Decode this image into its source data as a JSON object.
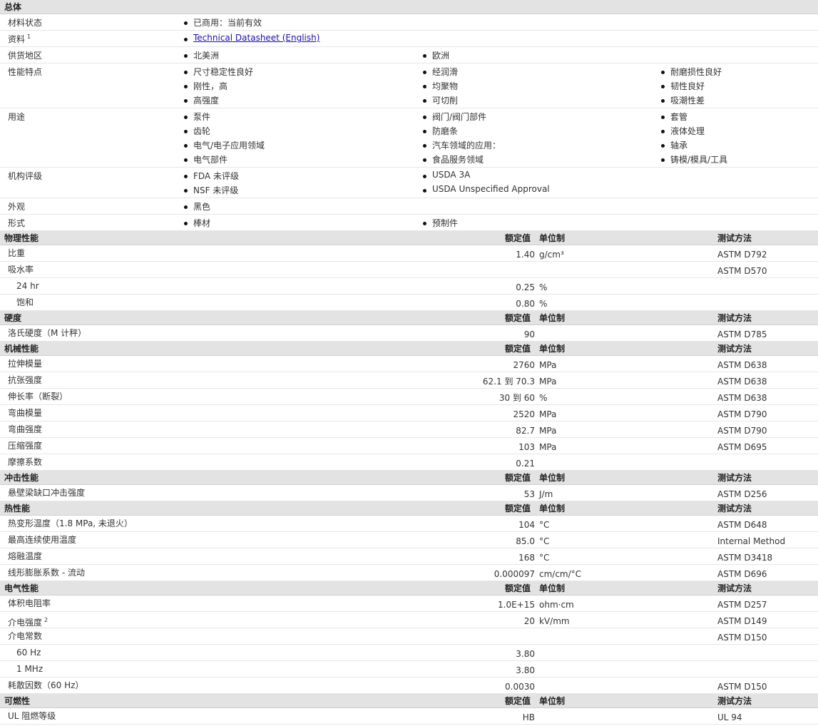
{
  "general": {
    "title": "总体",
    "rows": [
      {
        "label": "材料状态",
        "sup": "",
        "height": 0,
        "items": [
          {
            "text": "已商用：当前有效",
            "col": 0,
            "line": 0
          }
        ]
      },
      {
        "label": "资料",
        "sup": "1",
        "items": [
          {
            "text": "Technical Datasheet (English)",
            "col": 0,
            "line": 0,
            "link": true
          }
        ]
      },
      {
        "label": "供货地区",
        "sup": "",
        "items": [
          {
            "text": "北美洲",
            "col": 0,
            "line": 0
          },
          {
            "text": "欧洲",
            "col": 1,
            "line": 0
          }
        ]
      },
      {
        "label": "性能特点",
        "sup": "",
        "items": [
          {
            "text": "尺寸稳定性良好",
            "col": 0,
            "line": 0
          },
          {
            "text": "经润滑",
            "col": 1,
            "line": 0
          },
          {
            "text": "耐磨损性良好",
            "col": 2,
            "line": 0
          },
          {
            "text": "刚性，高",
            "col": 0,
            "line": 1
          },
          {
            "text": "均聚物",
            "col": 1,
            "line": 1
          },
          {
            "text": "韧性良好",
            "col": 2,
            "line": 1
          },
          {
            "text": "高强度",
            "col": 0,
            "line": 2
          },
          {
            "text": "可切削",
            "col": 1,
            "line": 2
          },
          {
            "text": "吸潮性差",
            "col": 2,
            "line": 2
          }
        ]
      },
      {
        "label": "用途",
        "sup": "",
        "items": [
          {
            "text": "泵件",
            "col": 0,
            "line": 0
          },
          {
            "text": "阀门/阀门部件",
            "col": 1,
            "line": 0
          },
          {
            "text": "套管",
            "col": 2,
            "line": 0
          },
          {
            "text": "齿轮",
            "col": 0,
            "line": 1
          },
          {
            "text": "防磨条",
            "col": 1,
            "line": 1
          },
          {
            "text": "液体处理",
            "col": 2,
            "line": 1
          },
          {
            "text": "电气/电子应用领域",
            "col": 0,
            "line": 2
          },
          {
            "text": "汽车领域的应用：",
            "col": 1,
            "line": 2
          },
          {
            "text": "轴承",
            "col": 2,
            "line": 2
          },
          {
            "text": "电气部件",
            "col": 0,
            "line": 3
          },
          {
            "text": "食品服务领域",
            "col": 1,
            "line": 3
          },
          {
            "text": "铸模/模具/工具",
            "col": 2,
            "line": 3
          }
        ]
      },
      {
        "label": "机构评级",
        "sup": "",
        "items": [
          {
            "text": "FDA 未评级",
            "col": 0,
            "line": 0
          },
          {
            "text": "USDA 3A",
            "col": 1,
            "line": 0
          },
          {
            "text": "NSF 未评级",
            "col": 0,
            "line": 1
          },
          {
            "text": "USDA Unspecified Approval",
            "col": 1,
            "line": 1
          }
        ]
      },
      {
        "label": "外观",
        "sup": "",
        "items": [
          {
            "text": "黑色",
            "col": 0,
            "line": 0
          }
        ]
      },
      {
        "label": "形式",
        "sup": "",
        "items": [
          {
            "text": "棒材",
            "col": 0,
            "line": 0
          },
          {
            "text": "预制件",
            "col": 1,
            "line": 0
          }
        ]
      }
    ]
  },
  "headers": {
    "nominal": "额定值",
    "unit": "单位制",
    "method": "测试方法"
  },
  "sections": [
    {
      "title": "物理性能",
      "rows": [
        {
          "label": "比重",
          "sub": false,
          "value": "1.40",
          "unit": "g/cm³",
          "method": "ASTM D792"
        },
        {
          "label": "吸水率",
          "sub": false,
          "value": "",
          "unit": "",
          "method": "ASTM D570"
        },
        {
          "label": "24 hr",
          "sub": true,
          "value": "0.25",
          "unit": "%",
          "method": ""
        },
        {
          "label": "饱和",
          "sub": true,
          "value": "0.80",
          "unit": "%",
          "method": ""
        }
      ]
    },
    {
      "title": "硬度",
      "rows": [
        {
          "label": "洛氏硬度（M 计秤）",
          "sub": false,
          "value": "90",
          "unit": "",
          "method": "ASTM D785"
        }
      ]
    },
    {
      "title": "机械性能",
      "rows": [
        {
          "label": "拉伸模量",
          "sub": false,
          "value": "2760",
          "unit": "MPa",
          "method": "ASTM D638"
        },
        {
          "label": "抗张强度",
          "sub": false,
          "value": "62.1 到  70.3",
          "unit": "MPa",
          "method": "ASTM D638"
        },
        {
          "label": "伸长率（断裂）",
          "sub": false,
          "value": "30 到  60",
          "unit": "%",
          "method": "ASTM D638"
        },
        {
          "label": "弯曲模量",
          "sub": false,
          "value": "2520",
          "unit": "MPa",
          "method": "ASTM D790"
        },
        {
          "label": "弯曲强度",
          "sub": false,
          "value": "82.7",
          "unit": "MPa",
          "method": "ASTM D790"
        },
        {
          "label": "压缩强度",
          "sub": false,
          "value": "103",
          "unit": "MPa",
          "method": "ASTM D695"
        },
        {
          "label": "摩擦系数",
          "sub": false,
          "value": "0.21",
          "unit": "",
          "method": ""
        }
      ]
    },
    {
      "title": "冲击性能",
      "rows": [
        {
          "label": "悬壁梁缺口冲击强度",
          "sub": false,
          "value": "53",
          "unit": "J/m",
          "method": "ASTM D256"
        }
      ]
    },
    {
      "title": "热性能",
      "rows": [
        {
          "label": "热变形温度（1.8 MPa, 未退火）",
          "sub": false,
          "value": "104",
          "unit": "°C",
          "method": "ASTM D648"
        },
        {
          "label": "最高连续使用温度",
          "sub": false,
          "value": "85.0",
          "unit": "°C",
          "method": "Internal Method"
        },
        {
          "label": "熔融温度",
          "sub": false,
          "value": "168",
          "unit": "°C",
          "method": "ASTM D3418"
        },
        {
          "label": "线形膨胀系数  - 流动",
          "sub": false,
          "value": "0.000097",
          "unit": "cm/cm/°C",
          "method": "ASTM D696"
        }
      ]
    },
    {
      "title": "电气性能",
      "rows": [
        {
          "label": "体积电阻率",
          "sub": false,
          "value": "1.0E+15",
          "unit": "ohm·cm",
          "method": "ASTM D257"
        },
        {
          "label": "介电强度",
          "sup": "2",
          "sub": false,
          "value": "20",
          "unit": "kV/mm",
          "method": "ASTM D149"
        },
        {
          "label": "介电常数",
          "sub": false,
          "value": "",
          "unit": "",
          "method": "ASTM D150"
        },
        {
          "label": "60 Hz",
          "sub": true,
          "value": "3.80",
          "unit": "",
          "method": ""
        },
        {
          "label": "1 MHz",
          "sub": true,
          "value": "3.80",
          "unit": "",
          "method": ""
        },
        {
          "label": "耗散因数（60 Hz）",
          "sub": false,
          "value": "0.0030",
          "unit": "",
          "method": "ASTM D150"
        }
      ]
    },
    {
      "title": "可燃性",
      "rows": [
        {
          "label": "UL 阻燃等级",
          "sub": false,
          "value": "HB",
          "unit": "",
          "method": "UL 94"
        }
      ]
    }
  ]
}
